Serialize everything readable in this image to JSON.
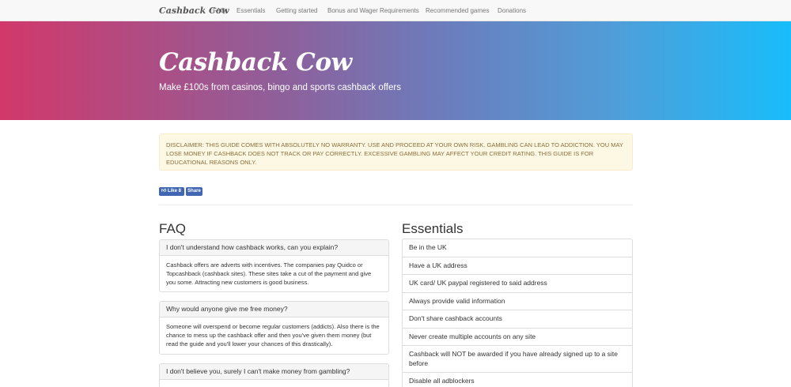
{
  "nav": {
    "brand": "Cashback Cow",
    "links": [
      "FAQ",
      "Essentials",
      "Getting started",
      "Bonus and Wager Requirements",
      "Recommended games",
      "Donations"
    ]
  },
  "hero": {
    "title": "Cashback Cow",
    "subtitle": "Make £100s from casinos, bingo and sports cashback offers"
  },
  "disclaimer": "DISCLAIMER: THIS GUIDE COMES WITH ABSOLUTELY NO WARRANTY. USE AND PROCEED AT YOUR OWN RISK. GAMBLING CAN LEAD TO ADDICTION. YOU MAY LOSE MONEY IF CASHBACK DOES NOT TRACK OR PAY CORRECTLY. EXCESSIVE GAMBLING MAY AFFECT YOUR CREDIT RATING. THIS GUIDE IS FOR EDUCATIONAL REASONS ONLY.",
  "social": {
    "like_label": "Like 8",
    "share_label": "Share"
  },
  "faq": {
    "title": "FAQ",
    "items": [
      {
        "question": "I don't understand how cashback works, can you explain?",
        "answer": "Cashback offers are adverts with incentives. The companies pay Quidco or Topcashback (cashback sites). These sites take a cut of the payment and give you some. Attracting new customers is good business."
      },
      {
        "question": "Why would anyone give me free money?",
        "answer": "Someone will overspend or become regular customers (addicts). Also there is the chance to mess up the cashback offer and then you've given them money (but read the guide and you'll lower your chances of this drastically)."
      },
      {
        "question": "I don't believe you, surely I can't make money from gambling?",
        "answer": ""
      }
    ]
  },
  "essentials": {
    "title": "Essentials",
    "items": [
      "Be in the UK",
      "Have a UK address",
      "UK card/ UK paypal registered to said address",
      "Always provide valid information",
      "Don't share cashback accounts",
      "Never create multiple accounts on any site",
      "Cashback will NOT be awarded if you have already signed up to a site before",
      "Disable all adblockers"
    ]
  }
}
